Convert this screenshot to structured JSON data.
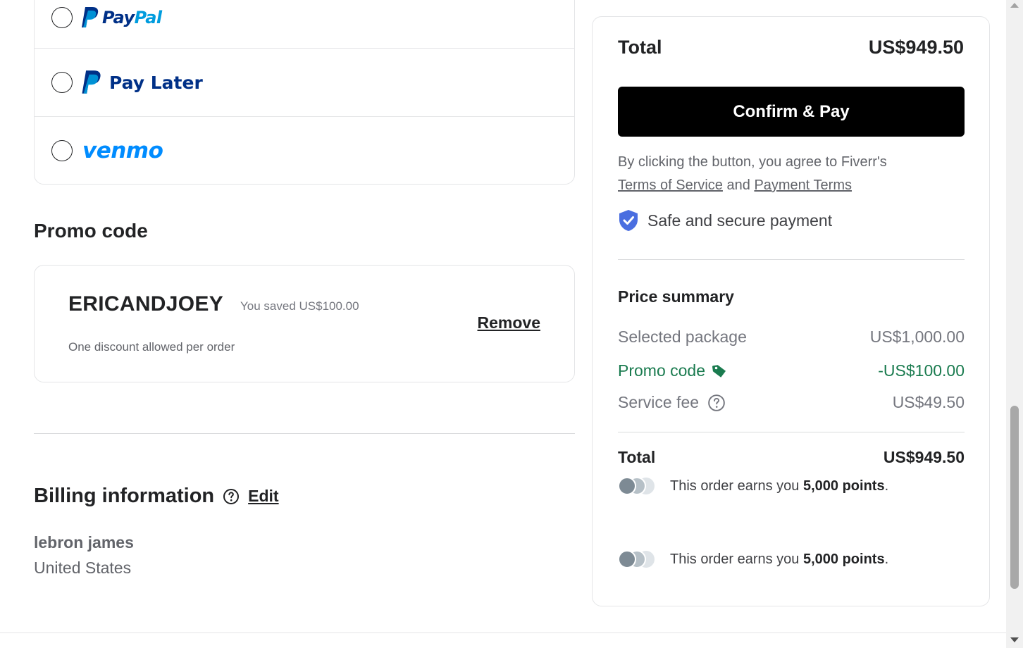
{
  "payment_methods": {
    "paypal": {
      "logo_text_a": "Pay",
      "logo_text_b": "Pal"
    },
    "paylater": {
      "label": "Pay Later"
    },
    "venmo": {
      "label": "venmo"
    }
  },
  "promo": {
    "section_title": "Promo code",
    "code": "ERICANDJOEY",
    "saved_text": "You saved US$100.00",
    "note": "One discount allowed per order",
    "remove_label": "Remove"
  },
  "billing": {
    "title": "Billing information",
    "edit_label": "Edit",
    "name": "lebron james",
    "country": "United States"
  },
  "summary": {
    "total_label": "Total",
    "total_value": "US$949.50",
    "confirm_label": "Confirm & Pay",
    "agree_prefix": "By clicking the button, you agree to Fiverr's",
    "terms_link": "Terms of Service",
    "agree_and": "and",
    "payment_terms_link": "Payment Terms",
    "secure_text": "Safe and secure payment",
    "price_summary_title": "Price summary",
    "rows": [
      {
        "label": "Selected package",
        "value": "US$1,000.00"
      },
      {
        "label": "Promo code",
        "value": "-US$100.00"
      },
      {
        "label": "Service fee",
        "value": "US$49.50"
      }
    ],
    "final_total_label": "Total",
    "final_total_value": "US$949.50",
    "points_prefix": "This order earns you",
    "points_amount": "5,000 points",
    "points_suffix": "."
  },
  "colors": {
    "promo_green": "#1a7b4f",
    "shield_blue": "#4a6ee0",
    "paypal_dark": "#003087",
    "paypal_light": "#009cde",
    "venmo_blue": "#008cff"
  }
}
